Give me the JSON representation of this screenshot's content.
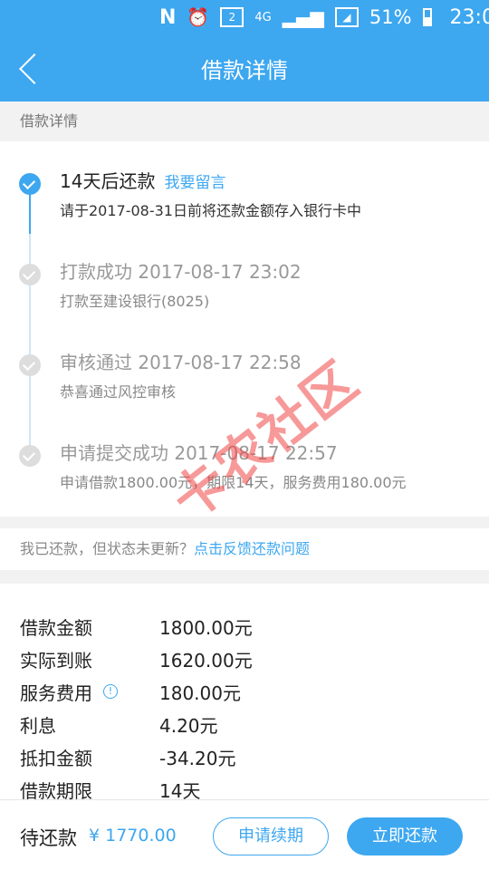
{
  "status_bar": {
    "n_icon": "N",
    "alarm_icon": "alarm-icon",
    "sim_label": "2",
    "network": "4G",
    "battery": "51%",
    "time": "23:05"
  },
  "nav": {
    "title": "借款详情",
    "back_icon": "chevron-left-icon"
  },
  "section_label": "借款详情",
  "timeline": [
    {
      "title": "14天后还款",
      "link": "我要留言",
      "sub": "请于2017-08-31日前将还款金额存入银行卡中",
      "active": true
    },
    {
      "title": "打款成功 2017-08-17 23:02",
      "sub": "打款至建设银行(8025)",
      "active": false
    },
    {
      "title": "审核通过 2017-08-17 22:58",
      "sub": "恭喜通过风控审核",
      "active": false
    },
    {
      "title": "申请提交成功 2017-08-17 22:57",
      "sub": "申请借款1800.00元，期限14天，服务费用180.00元",
      "active": false
    }
  ],
  "feedback": {
    "text": "我已还款，但状态未更新？",
    "link": "点击反馈还款问题"
  },
  "details": [
    {
      "label": "借款金额",
      "value": "1800.00元"
    },
    {
      "label": "实际到账",
      "value": "1620.00元"
    },
    {
      "label": "服务费用",
      "value": "180.00元",
      "info": "!"
    },
    {
      "label": "利息",
      "value": "4.20元"
    },
    {
      "label": "抵扣金额",
      "value": "-34.20元"
    },
    {
      "label": "借款期限",
      "value": "14天"
    }
  ],
  "bottom": {
    "due_label": "待还款",
    "due_amount": "¥ 1770.00",
    "renew_label": "申请续期",
    "repay_label": "立即还款"
  },
  "watermark": "卡农社区",
  "colors": {
    "accent": "#3da7f0",
    "watermark": "#f04646"
  }
}
